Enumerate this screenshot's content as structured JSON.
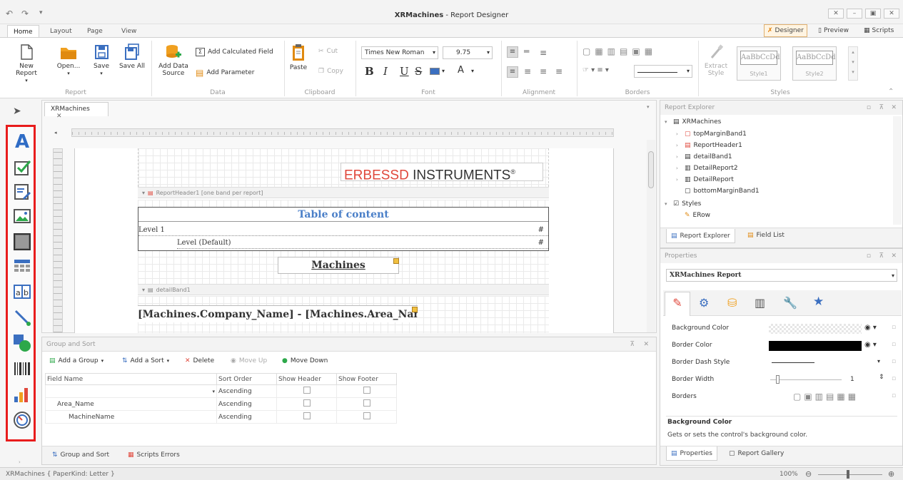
{
  "window": {
    "app_title": "XRMachines",
    "title_suffix": " - Report Designer"
  },
  "ribbon_tabs": [
    "Home",
    "Layout",
    "Page",
    "View"
  ],
  "view_tabs": [
    "Designer",
    "Preview",
    "Scripts"
  ],
  "ribbon": {
    "report": {
      "new_report": "New Report",
      "open": "Open...",
      "save": "Save",
      "save_all": "Save All",
      "label": "Report"
    },
    "data": {
      "add_data_source_1": "Add Data",
      "add_data_source_2": "Source",
      "add_calculated_field": "Add Calculated Field",
      "add_parameter": "Add Parameter",
      "label": "Data"
    },
    "clipboard": {
      "paste": "Paste",
      "cut": "Cut",
      "copy": "Copy",
      "label": "Clipboard"
    },
    "font": {
      "family": "Times New Roman",
      "size": "9.75",
      "bold": "B",
      "italic": "I",
      "underline": "U",
      "strike": "S",
      "color_letter": "A",
      "label": "Font"
    },
    "alignment": {
      "label": "Alignment"
    },
    "borders": {
      "label": "Borders"
    },
    "styles": {
      "extract_1": "Extract",
      "extract_2": "Style",
      "style1_preview": "AaBbCcDd",
      "style1_name": "Style1",
      "style2_preview": "AaBbCcDd",
      "style2_name": "Style2",
      "label": "Styles"
    }
  },
  "toolbox": {
    "tools": [
      "pointer",
      "label",
      "checkbox",
      "rich-text",
      "picture",
      "panel",
      "table",
      "character-comb",
      "line",
      "shape",
      "barcode",
      "chart",
      "gauge"
    ]
  },
  "designer": {
    "tab_label": "XRMachines",
    "logo_text_brand": "ERBESSD",
    "logo_text_rest": " INSTRUMENTS",
    "logo_reg": "®",
    "band_report_header": "ReportHeader1 [one band per report]",
    "toc_title": "Table of content",
    "toc_level1": "Level  1",
    "toc_level1_num": "#",
    "toc_level_default": "Level  (Default)",
    "toc_level_default_num": "#",
    "machines_label": "Machines",
    "band_detail": "detailBand1",
    "detail_expr": "[Machines.Company_Name] - [Machines.Area_Nam"
  },
  "group_sort": {
    "title": "Group and Sort",
    "add_group": "Add a Group",
    "add_sort": "Add a Sort",
    "delete": "Delete",
    "move_up": "Move Up",
    "move_down": "Move Down",
    "columns": [
      "Field Name",
      "Sort Order",
      "Show Header",
      "Show Footer"
    ],
    "rows": [
      {
        "field": "",
        "order": "Ascending"
      },
      {
        "field": "Area_Name",
        "order": "Ascending"
      },
      {
        "field": "MachineName",
        "order": "Ascending"
      }
    ],
    "tab_group_sort": "Group and Sort",
    "tab_scripts_errors": "Scripts Errors"
  },
  "explorer": {
    "title": "Report Explorer",
    "items": [
      {
        "label": "XRMachines"
      },
      {
        "label": "topMarginBand1"
      },
      {
        "label": "ReportHeader1"
      },
      {
        "label": "detailBand1"
      },
      {
        "label": "DetailReport2"
      },
      {
        "label": "DetailReport"
      },
      {
        "label": "bottomMarginBand1"
      },
      {
        "label": "Styles"
      },
      {
        "label": "ERow"
      }
    ],
    "tab_explorer": "Report Explorer",
    "tab_field_list": "Field List"
  },
  "properties": {
    "title": "Properties",
    "selected": "XRMachines  Report",
    "rows": [
      {
        "label": "Background Color"
      },
      {
        "label": "Border Color"
      },
      {
        "label": "Border Dash Style"
      },
      {
        "label": "Border Width",
        "value": "1"
      },
      {
        "label": "Borders"
      }
    ],
    "desc_title": "Background Color",
    "desc_text": "Gets or sets the control's background color.",
    "tab_properties": "Properties",
    "tab_gallery": "Report Gallery"
  },
  "status": {
    "paper": "XRMachines { PaperKind: Letter }",
    "zoom": "100%"
  },
  "colors": {
    "toolbox_border": "#e81c1c",
    "accent": "#3b6fc0",
    "brand_red": "#e0483c"
  }
}
